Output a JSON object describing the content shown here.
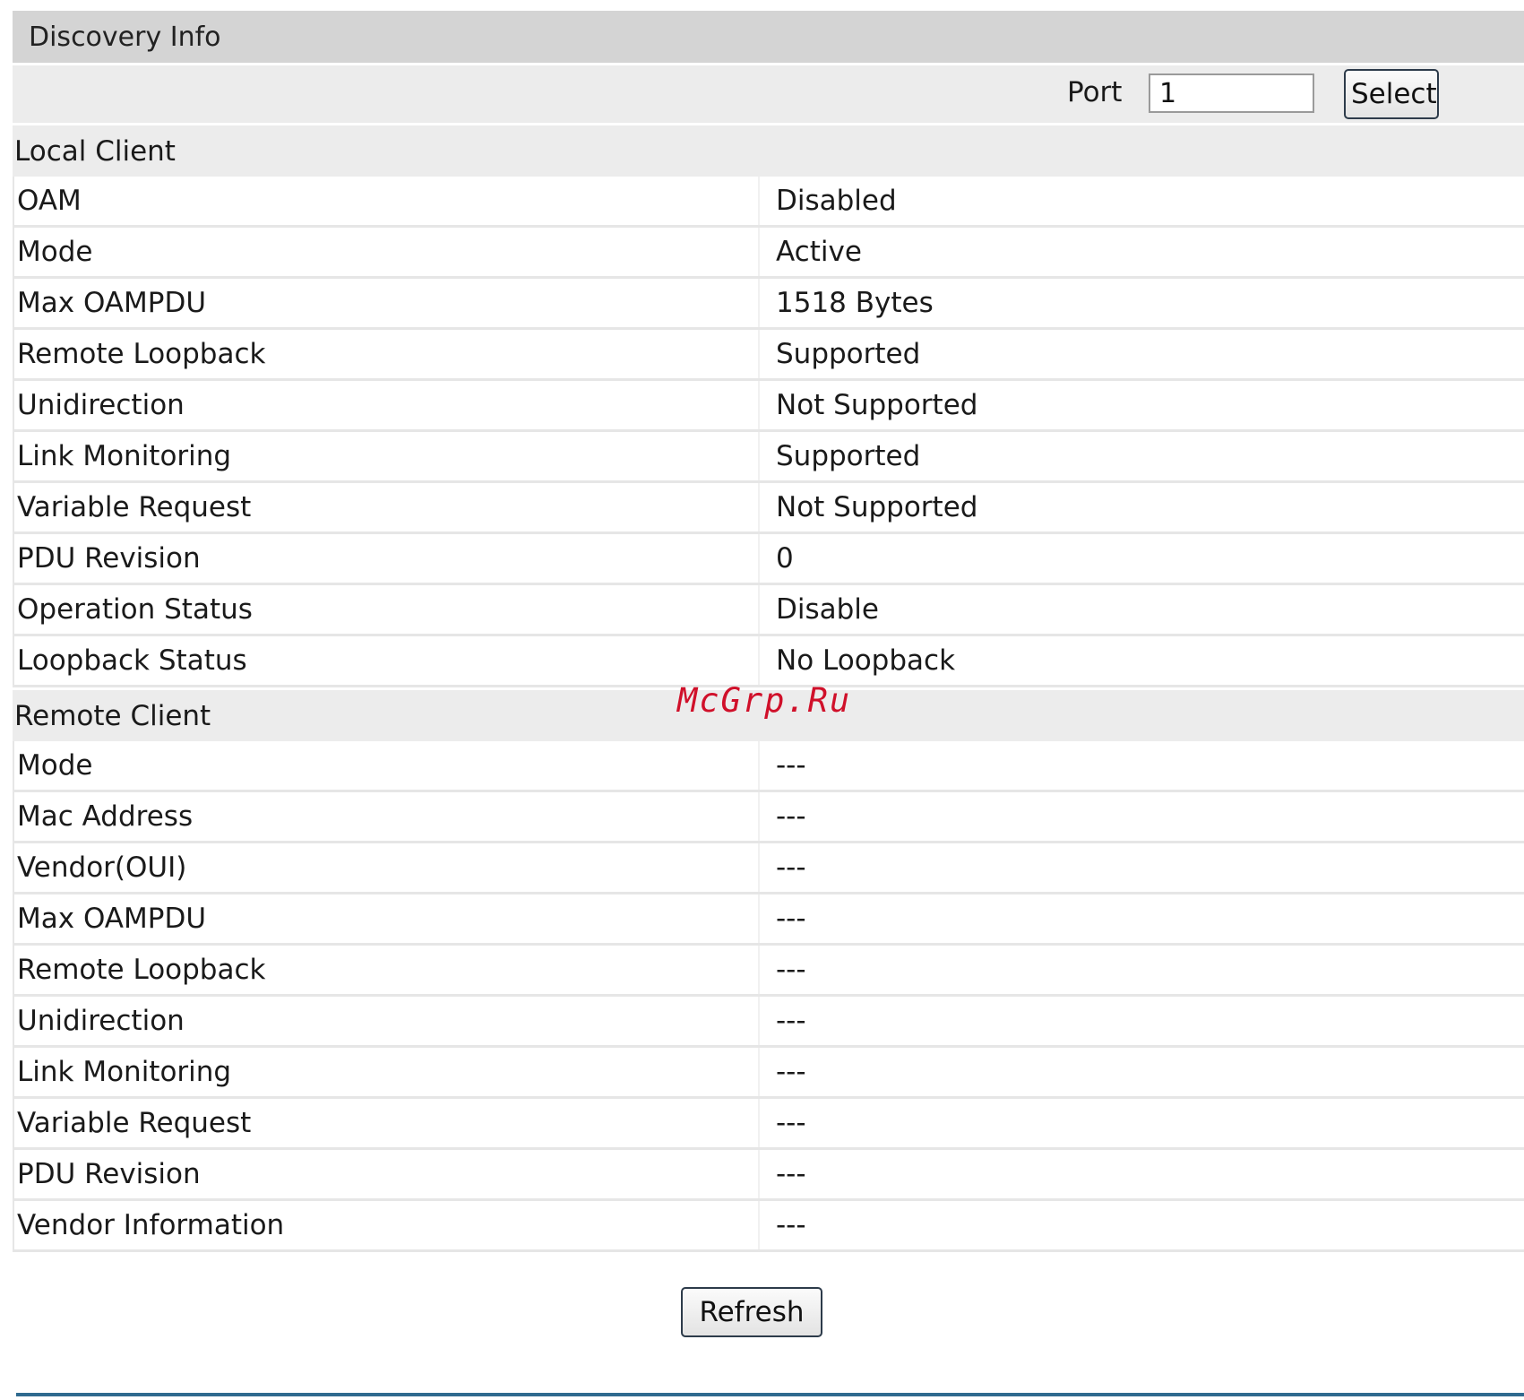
{
  "title": "Discovery Info",
  "port": {
    "label": "Port",
    "value": "1",
    "select_label": "Select"
  },
  "local_client": {
    "header": "Local Client",
    "rows": [
      {
        "label": "OAM",
        "value": "Disabled"
      },
      {
        "label": "Mode",
        "value": "Active"
      },
      {
        "label": "Max OAMPDU",
        "value": "1518 Bytes"
      },
      {
        "label": "Remote Loopback",
        "value": "Supported"
      },
      {
        "label": "Unidirection",
        "value": "Not Supported"
      },
      {
        "label": "Link Monitoring",
        "value": "Supported"
      },
      {
        "label": "Variable Request",
        "value": "Not Supported"
      },
      {
        "label": "PDU Revision",
        "value": "0"
      },
      {
        "label": "Operation Status",
        "value": "Disable"
      },
      {
        "label": "Loopback Status",
        "value": "No Loopback"
      }
    ]
  },
  "remote_client": {
    "header": "Remote Client",
    "rows": [
      {
        "label": "Mode",
        "value": "---"
      },
      {
        "label": "Mac Address",
        "value": "---"
      },
      {
        "label": "Vendor(OUI)",
        "value": "---"
      },
      {
        "label": "Max OAMPDU",
        "value": "---"
      },
      {
        "label": "Remote Loopback",
        "value": "---"
      },
      {
        "label": "Unidirection",
        "value": "---"
      },
      {
        "label": "Link Monitoring",
        "value": "---"
      },
      {
        "label": "Variable Request",
        "value": "---"
      },
      {
        "label": "PDU Revision",
        "value": "---"
      },
      {
        "label": "Vendor Information",
        "value": "---"
      }
    ]
  },
  "refresh_label": "Refresh",
  "watermark": "McGrp.Ru"
}
